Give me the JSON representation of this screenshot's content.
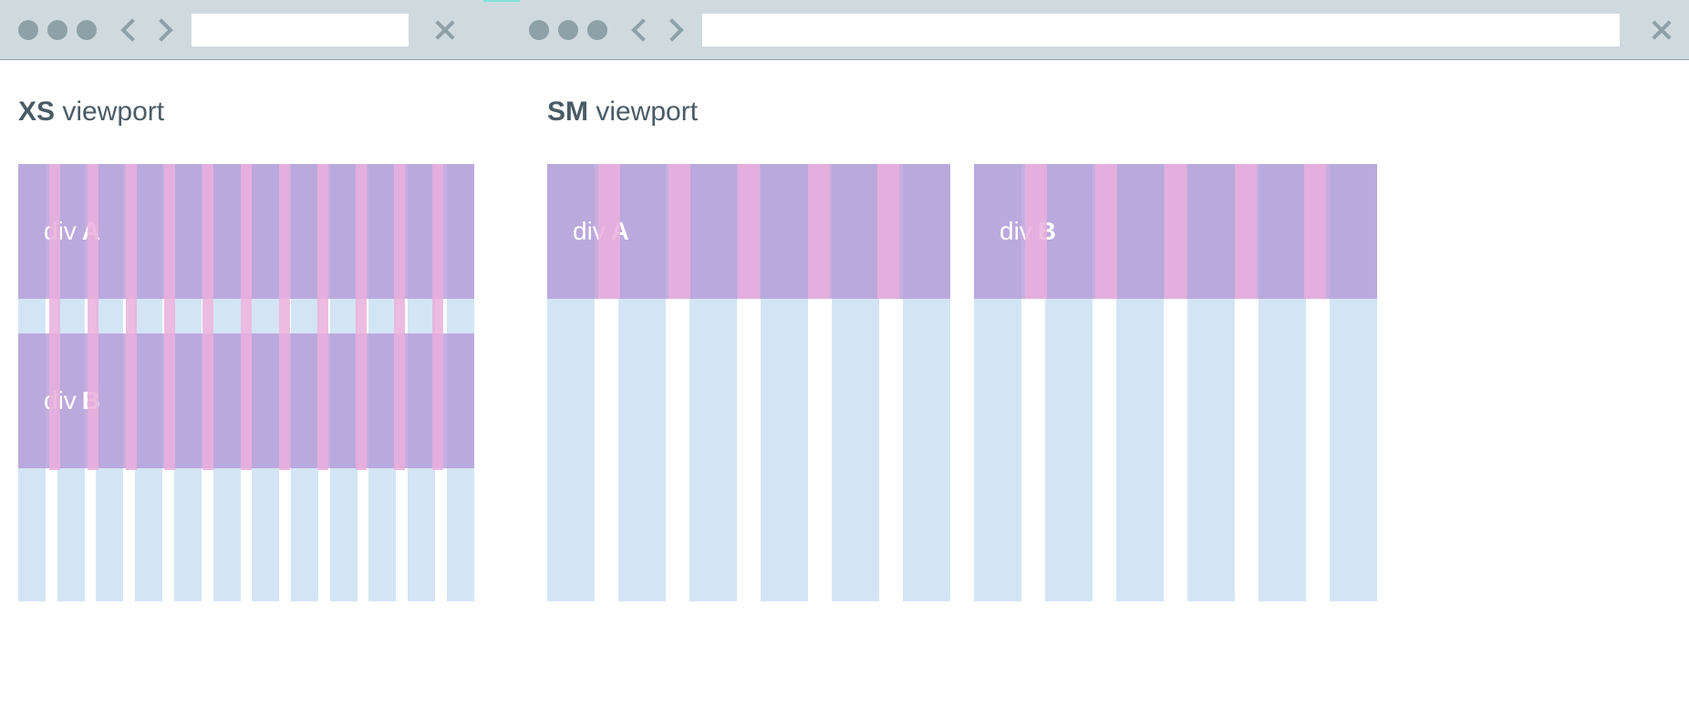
{
  "toolbar": {
    "left_url_value": "",
    "right_url_value": ""
  },
  "panels": {
    "xs": {
      "label_bold": "XS",
      "label_rest": " viewport",
      "columns": 12,
      "gutters": 11,
      "blocks": [
        {
          "text": "div ",
          "bold": "A"
        },
        {
          "text": "div ",
          "bold": "B"
        }
      ]
    },
    "sm": {
      "label_bold": "SM",
      "label_rest": " viewport",
      "columns_per_half": 6,
      "gutters_per_half": 5,
      "blocks": [
        {
          "text": "div ",
          "bold": "A"
        },
        {
          "text": "div ",
          "bold": "B"
        }
      ]
    }
  },
  "colors": {
    "toolbar_bg": "#cfdadf",
    "toolbar_icon": "#8ea0a8",
    "grid_col": "#d3e5f4",
    "block_purple": "rgba(178,148,214,0.75)",
    "gutter_pink": "rgba(233,175,221,0.85)",
    "heading_text": "#4a5b66",
    "accent_top": "#7fe3d6"
  }
}
